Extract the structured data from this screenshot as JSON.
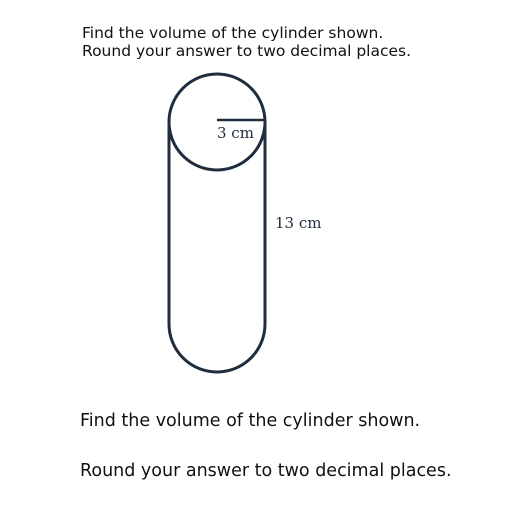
{
  "header": {
    "line1": "Find the volume of the cylinder shown.",
    "line2": "Round your answer to two decimal places."
  },
  "diagram": {
    "radius_label": "3 cm",
    "height_label": "13 cm",
    "stroke_color": "#1f2d3d"
  },
  "footer": {
    "line1": "Find the volume of the cylinder shown.",
    "line2": "Round your answer to two decimal places."
  }
}
